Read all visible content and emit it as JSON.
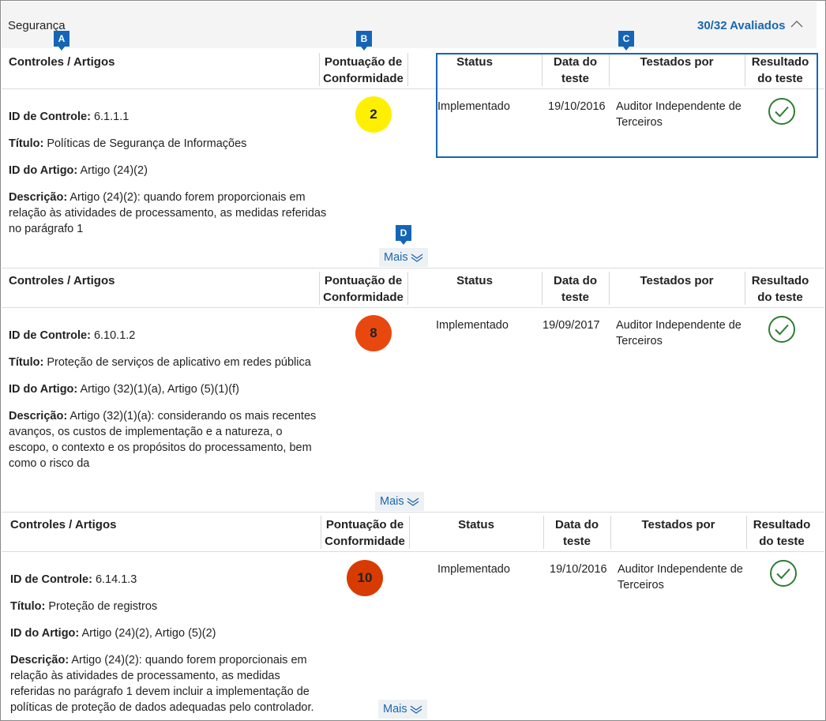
{
  "header": {
    "section_title": "Segurança",
    "evaluated": "30/32 Avaliados"
  },
  "columns": {
    "controls": "Controles / Artigos",
    "score_line1": "Pontuação de",
    "score_line2": "Conformidade",
    "status": "Status",
    "date_line1": "Data do",
    "date_line2": "teste",
    "tested_by": "Testados por",
    "result_line1": "Resultado",
    "result_line2": "do teste"
  },
  "labels": {
    "control_id": "ID de Controle:",
    "title": "Título:",
    "article_id": "ID do Artigo:",
    "description": "Descrição:",
    "more": "Mais"
  },
  "markers": [
    "A",
    "B",
    "C",
    "D"
  ],
  "controls": [
    {
      "control_id": "6.1.1.1",
      "title": "Políticas de Segurança de Informações",
      "article_id": "Artigo (24)(2)",
      "description": "Artigo (24)(2): quando forem proporcionais em relação às atividades de processamento, as medidas referidas no parágrafo 1",
      "score": "2",
      "score_color": "#ffef00",
      "status": "Implementado",
      "date": "19/10/2016",
      "tested_by": "Auditor Independente de Terceiros",
      "result_icon": "check-circle-icon"
    },
    {
      "control_id": "6.10.1.2",
      "title": "Proteção de serviços de aplicativo em redes pública",
      "article_id": "Artigo (32)(1)(a), Artigo (5)(1)(f)",
      "description": "Artigo (32)(1)(a): considerando os mais recentes avanços, os custos de implementação e a natureza, o escopo, o contexto e os propósitos do processamento, bem como o risco da",
      "score": "8",
      "score_color": "#e8480e",
      "status": "Implementado",
      "date": "19/09/2017",
      "tested_by": "Auditor Independente de Terceiros",
      "result_icon": "check-circle-icon"
    },
    {
      "control_id": "6.14.1.3",
      "title": "Proteção de registros",
      "article_id": "Artigo (24)(2), Artigo (5)(2)",
      "description": "Artigo (24)(2): quando forem proporcionais em relação às atividades de processamento, as medidas referidas no parágrafo 1 devem incluir a implementação de políticas de proteção de dados adequadas pelo controlador.",
      "score": "10",
      "score_color": "#d83b01",
      "status": "Implementado",
      "date": "19/10/2016",
      "tested_by": "Auditor Independente de Terceiros",
      "result_icon": "check-circle-icon"
    }
  ],
  "colors": {
    "accent": "#1a66b0",
    "marker": "#1565b6",
    "check": "#2e7d32"
  }
}
